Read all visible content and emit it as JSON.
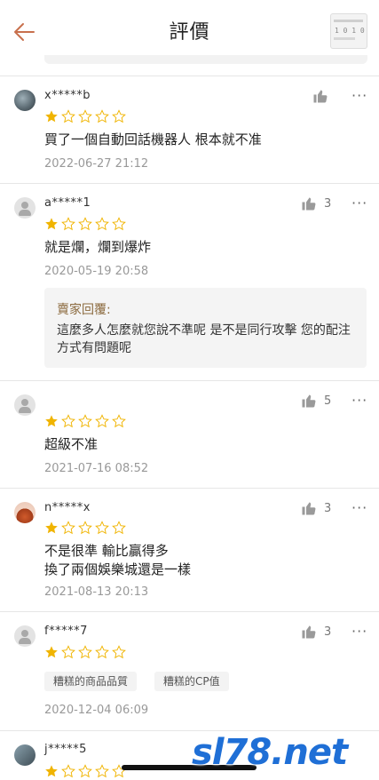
{
  "header": {
    "title": "評價",
    "thumbnail_text": "1 0 1 0"
  },
  "reviews": [
    {
      "username": "x*****b",
      "rating": 1,
      "text": "買了一個自動回話機器人 根本就不准",
      "timestamp": "2022-06-27 21:12",
      "likes": ""
    },
    {
      "username": "a*****1",
      "rating": 1,
      "text": "就是爛，爛到爆炸",
      "timestamp": "2020-05-19 20:58",
      "likes": "3",
      "seller_reply_label": "賣家回覆:",
      "seller_reply_text": "這麼多人怎麼就您說不準呢 是不是同行攻擊 您的配注方式有問題呢"
    },
    {
      "username": "",
      "rating": 1,
      "text": "超級不准",
      "timestamp": "2021-07-16 08:52",
      "likes": "5"
    },
    {
      "username": "n*****x",
      "rating": 1,
      "text_line1": "不是很準 輸比贏得多",
      "text_line2": "換了兩個娛樂城還是一樣",
      "timestamp": "2021-08-13 20:13",
      "likes": "3"
    },
    {
      "username": "f*****7",
      "rating": 1,
      "tags": [
        "糟糕的商品品質",
        "糟糕的CP值"
      ],
      "timestamp": "2020-12-04 06:09",
      "likes": "3"
    },
    {
      "username": "j*****5",
      "rating": 1
    }
  ],
  "more_icon": "···",
  "watermark": "sl78.net",
  "colors": {
    "accent_back": "#c8704d",
    "star_filled": "#f0b400",
    "star_empty_stroke": "#f0b400",
    "reply_label": "#8b6a3e",
    "watermark": "#1f6fd6"
  },
  "icons": [
    "back-arrow-icon",
    "thumbs-up-icon",
    "more-dots-icon",
    "star-icon",
    "default-avatar-icon"
  ]
}
